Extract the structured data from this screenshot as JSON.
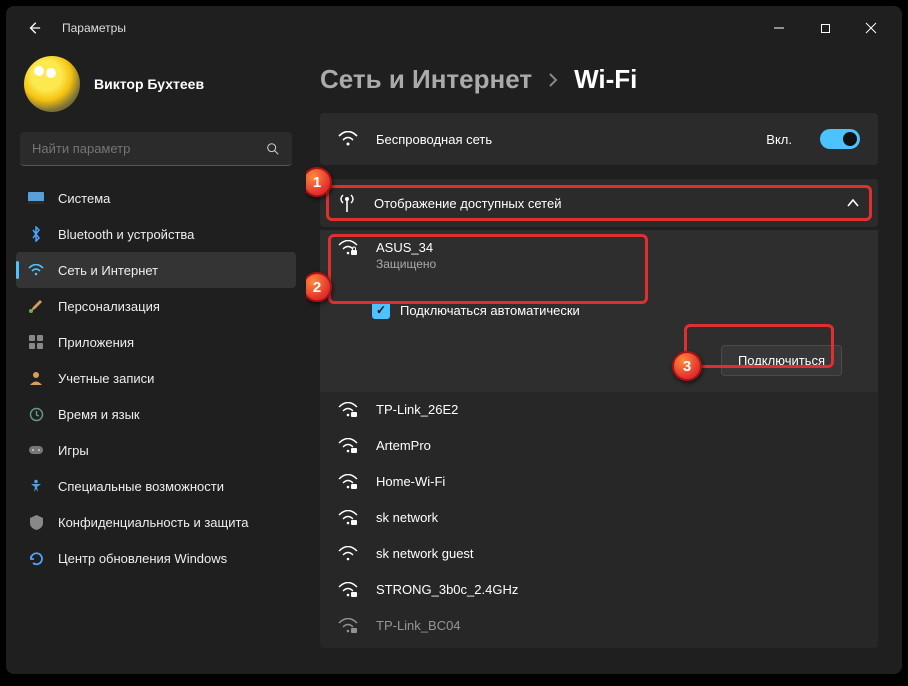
{
  "titlebar": {
    "title": "Параметры"
  },
  "profile": {
    "name": "Виктор Бухтеев",
    "sub": ""
  },
  "search": {
    "placeholder": "Найти параметр"
  },
  "sidebar": {
    "items": [
      {
        "label": "Система"
      },
      {
        "label": "Bluetooth и устройства"
      },
      {
        "label": "Сеть и Интернет"
      },
      {
        "label": "Персонализация"
      },
      {
        "label": "Приложения"
      },
      {
        "label": "Учетные записи"
      },
      {
        "label": "Время и язык"
      },
      {
        "label": "Игры"
      },
      {
        "label": "Специальные возможности"
      },
      {
        "label": "Конфиденциальность и защита"
      },
      {
        "label": "Центр обновления Windows"
      }
    ]
  },
  "breadcrumb": {
    "parent": "Сеть и Интернет",
    "current": "Wi-Fi"
  },
  "wireless": {
    "title": "Беспроводная сеть",
    "state": "Вкл."
  },
  "available": {
    "header": "Отображение доступных сетей"
  },
  "selected_network": {
    "name": "ASUS_34",
    "status": "Защищено",
    "auto_label": "Подключаться автоматически",
    "connect_label": "Подключиться"
  },
  "networks": [
    {
      "name": "TP-Link_26E2"
    },
    {
      "name": "ArtemPro"
    },
    {
      "name": "Home-Wi-Fi"
    },
    {
      "name": "sk network"
    },
    {
      "name": "sk network guest"
    },
    {
      "name": "STRONG_3b0c_2.4GHz"
    },
    {
      "name": "TP-Link_BC04"
    }
  ],
  "callouts": {
    "one": "1",
    "two": "2",
    "three": "3"
  }
}
